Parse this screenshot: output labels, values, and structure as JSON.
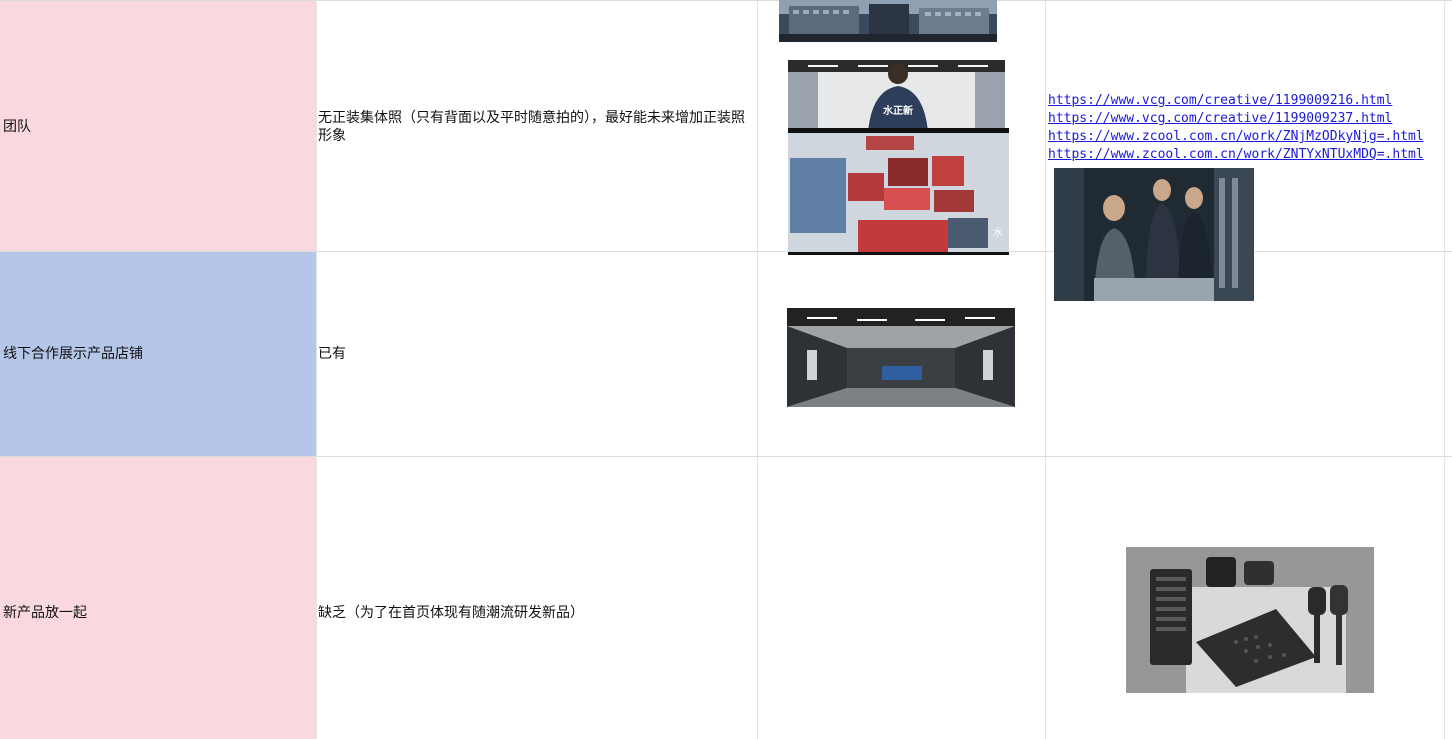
{
  "rows": [
    {
      "label": "团队",
      "status": "无正装集体照（只有背面以及平时随意拍的），最好能未来增加正装照形象",
      "color": "#f9d9df"
    },
    {
      "label": "线下合作展示产品店铺",
      "status": "已有",
      "color": "#b5c6e8"
    },
    {
      "label": "新产品放一起",
      "status": "缺乏（为了在首页体现有随潮流研发新品）",
      "color": "#f9d9df"
    }
  ],
  "links": [
    "https://www.vcg.com/creative/1199009216.html",
    "https://www.vcg.com/creative/1199009237.html",
    "https://www.zcool.com.cn/work/ZNjMzODkyNjg=.html",
    "https://www.zcool.com.cn/work/ZNTYxNTUxMDQ=.html"
  ],
  "images": {
    "building": "office-building-photo",
    "team_back": "team-member-back-photo",
    "team_collage": "team-photo-collage",
    "business_meeting": "business-people-server-room-photo",
    "showroom": "product-showroom-photo",
    "products": "new-shower-products-photo"
  },
  "photo_texts": {
    "team_back_logo": "水正新",
    "collage_brand": "水"
  },
  "colors": {
    "pink": "#f9d9df",
    "blue": "#b5c6e8",
    "link": "#1a1ad8",
    "grid": "#dcdcdc"
  }
}
